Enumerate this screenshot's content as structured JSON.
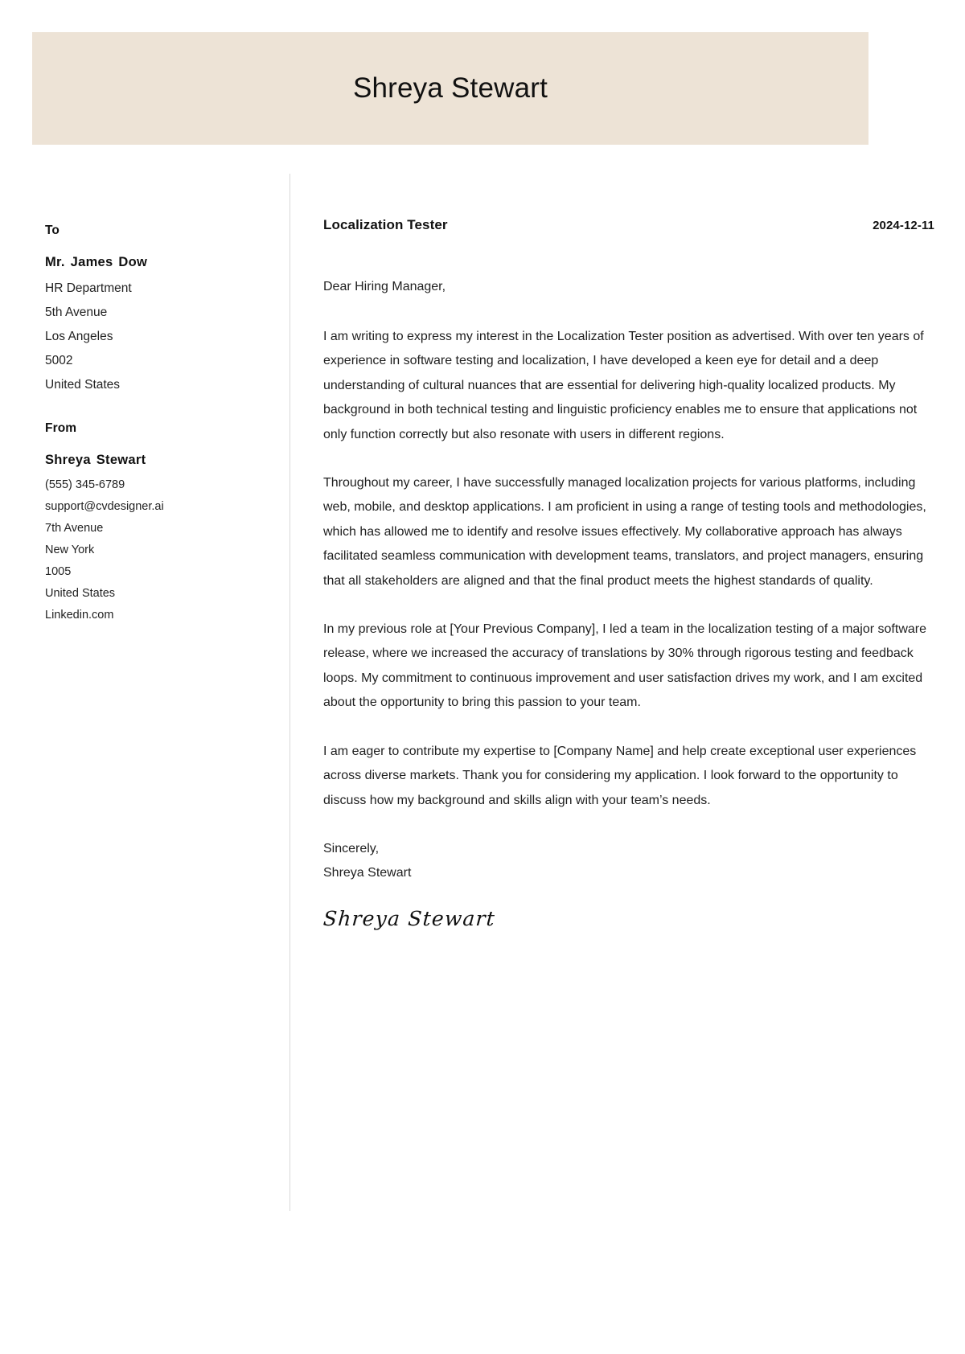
{
  "header": {
    "name": "Shreya Stewart",
    "band_color": "#ede3d6"
  },
  "sidebar": {
    "to": {
      "label": "To",
      "name": "Mr. James Dow",
      "lines": [
        "HR Department",
        "5th Avenue",
        "Los Angeles",
        "5002",
        "United States"
      ]
    },
    "from": {
      "label": "From",
      "name": "Shreya Stewart",
      "lines": [
        "(555) 345-6789",
        "support@cvdesigner.ai",
        "7th Avenue",
        "New York",
        "1005",
        "United States",
        "Linkedin.com"
      ]
    }
  },
  "letter": {
    "job_title": "Localization Tester",
    "date": "2024-12-11",
    "salutation": "Dear Hiring Manager,",
    "paragraphs": [
      "I am writing to express my interest in the Localization Tester position as advertised. With over ten years of experience in software testing and localization, I have developed a keen eye for detail and a deep understanding of cultural nuances that are essential for delivering high-quality localized products. My background in both technical testing and linguistic proficiency enables me to ensure that applications not only function correctly but also resonate with users in different regions.",
      "Throughout my career, I have successfully managed localization projects for various platforms, including web, mobile, and desktop applications. I am proficient in using a range of testing tools and methodologies, which has allowed me to identify and resolve issues effectively. My collaborative approach has always facilitated seamless communication with development teams, translators, and project managers, ensuring that all stakeholders are aligned and that the final product meets the highest standards of quality.",
      "In my previous role at [Your Previous Company], I led a team in the localization testing of a major software release, where we increased the accuracy of translations by 30% through rigorous testing and feedback loops. My commitment to continuous improvement and user satisfaction drives my work, and I am excited about the opportunity to bring this passion to your team.",
      "I am eager to contribute my expertise to [Company Name] and help create exceptional user experiences across diverse markets. Thank you for considering my application. I look forward to the opportunity to discuss how my background and skills align with your team’s needs."
    ],
    "closing": "Sincerely,",
    "closing_name": "Shreya Stewart",
    "signature": "Shreya Stewart"
  }
}
